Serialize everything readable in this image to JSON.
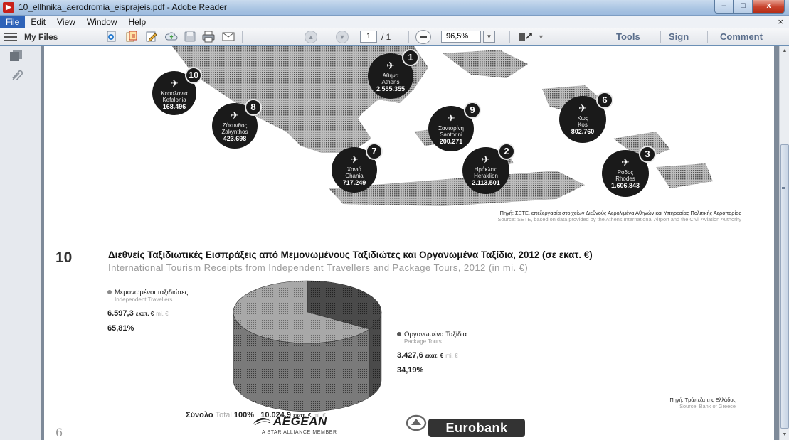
{
  "window": {
    "title": "10_ellhnika_aerodromia_eisprajeis.pdf - Adobe Reader",
    "app_icon": "adobe-reader-icon",
    "minimize": "–",
    "maximize": "□",
    "close": "x"
  },
  "menu": {
    "items": [
      "File",
      "Edit",
      "View",
      "Window",
      "Help"
    ],
    "close": "×"
  },
  "toolbar": {
    "my_files": "My Files",
    "page_current": "1",
    "page_total": "/ 1",
    "zoom": "96,5%",
    "tools": "Tools",
    "sign": "Sign",
    "comment": "Comment"
  },
  "map": {
    "markers": [
      {
        "num": "10",
        "gr": "Κεφαλονιά",
        "en": "Kefalonia",
        "value": "168.496"
      },
      {
        "num": "8",
        "gr": "Ζάκυνθος",
        "en": "Zakynthos",
        "value": "423.698"
      },
      {
        "num": "1",
        "gr": "Αθήνα",
        "en": "Athens",
        "value": "2.555.355"
      },
      {
        "num": "9",
        "gr": "Σαντορίνη",
        "en": "Santorini",
        "value": "200.271"
      },
      {
        "num": "6",
        "gr": "Κως",
        "en": "Kos",
        "value": "802.760"
      },
      {
        "num": "7",
        "gr": "Χανιά",
        "en": "Chania",
        "value": "717.249"
      },
      {
        "num": "2",
        "gr": "Ηράκλειο",
        "en": "Heraklion",
        "value": "2.113.501"
      },
      {
        "num": "3",
        "gr": "Ρόδος",
        "en": "Rhodes",
        "value": "1.606.843"
      }
    ],
    "source_gr": "Πηγή: ΣΕΤΕ, επεξεργασία στοιχείων Διεθνούς Αερολιμένα Αθηνών και Υπηρεσίας Πολιτικής Αεροπορίας",
    "source_en": "Source: SETE, based on data provided by the Athens International Airport and the Civil Aviation Authority"
  },
  "section": {
    "number": "10",
    "title_gr": "Διεθνείς Ταξιδιωτικές Εισπράξεις από Μεμονωμένους Ταξιδιώτες και Οργανωμένα Ταξίδια, 2012 (σε εκατ. €)",
    "title_en": "International Tourism Receipts from Independent Travellers and Package Tours, 2012 (in mi. €)"
  },
  "chart_data": {
    "type": "pie",
    "title": "Διεθνείς Ταξιδιωτικές Εισπράξεις από Μεμονωμένους Ταξιδιώτες και Οργανωμένα Ταξίδια, 2012 (σε εκατ. €)",
    "slices": [
      {
        "label_gr": "Μεμονωμένοι ταξιδιώτες",
        "label_en": "Independent Travellers",
        "amount": "6.597,3",
        "value": 6597.3,
        "percent": "65,81%",
        "color": "#8c8c8c"
      },
      {
        "label_gr": "Οργανωμένα Ταξίδια",
        "label_en": "Package Tours",
        "amount": "3.427,6",
        "value": 3427.6,
        "percent": "34,19%",
        "color": "#3d3d3d"
      }
    ],
    "unit_gr": "εκατ. €",
    "unit_en": "mi. €",
    "total": {
      "label_gr": "Σύνολο",
      "label_en": "Total",
      "percent": "100%",
      "amount": "10.024,9"
    }
  },
  "bank_source": {
    "gr": "Πηγή: Τράπεζα της Ελλάδος",
    "en": "Source: Bank of Greece"
  },
  "footer": {
    "page_number": "6",
    "aegean": "AEGEAN",
    "aegean_sub": "A STAR ALLIANCE MEMBER",
    "eurobank": "Eurobank"
  }
}
